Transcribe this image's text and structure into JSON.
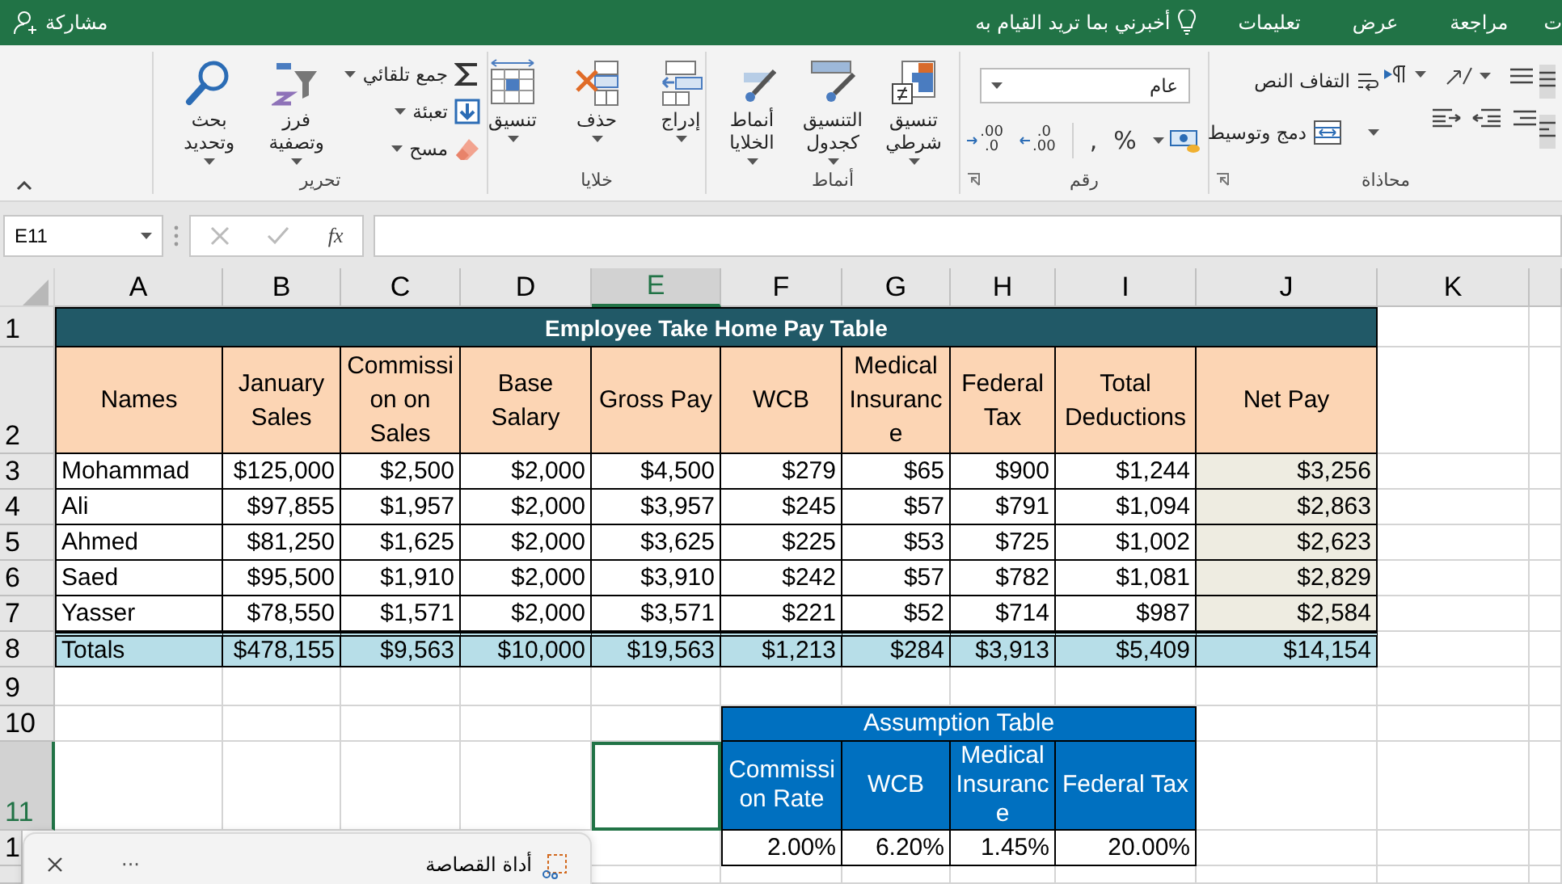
{
  "tabs": [
    {
      "label": "ت",
      "selected": false
    },
    {
      "label": "مراجعة",
      "selected": false
    },
    {
      "label": "عرض",
      "selected": false
    },
    {
      "label": "تعليمات",
      "selected": false
    }
  ],
  "tell_me": "أخبرني بما تريد القيام به",
  "share": "مشاركة",
  "ribbon": {
    "alignment": {
      "label": "محاذاة",
      "wrap_text": "التفاف النص",
      "merge_center": "دمج وتوسيط"
    },
    "number": {
      "label": "رقم",
      "format": "عام",
      "percent": "%",
      "comma": ",",
      "decimal_buttons": [
        {
          "kind": "decrease",
          "top": ".00",
          "bottom": ".0"
        },
        {
          "kind": "increase",
          "top": ".0",
          "bottom": ".00"
        }
      ]
    },
    "styles": {
      "label": "أنماط",
      "buttons": [
        {
          "kind": "conditional",
          "label": "تنسيق شرطي"
        },
        {
          "kind": "table",
          "label": "التنسيق كجدول"
        },
        {
          "kind": "cell_styles",
          "label": "أنماط الخلايا"
        }
      ]
    },
    "cells": {
      "label": "خلايا",
      "buttons": [
        {
          "kind": "insert",
          "label": "إدراج"
        },
        {
          "kind": "delete",
          "label": "حذف"
        },
        {
          "kind": "format",
          "label": "تنسيق"
        }
      ]
    },
    "editing": {
      "label": "تحرير",
      "small": [
        {
          "kind": "autosum",
          "label": "جمع تلقائي"
        },
        {
          "kind": "fill",
          "label": "تعبئة"
        },
        {
          "kind": "clear",
          "label": "مسح"
        }
      ],
      "buttons": [
        {
          "kind": "sort",
          "label": "فرز وتصفية"
        },
        {
          "kind": "find",
          "label": "بحث وتحديد"
        }
      ]
    }
  },
  "formula_bar": {
    "name_box": "E11",
    "function_button": "fx"
  },
  "column_headers": [
    {
      "label": "A",
      "selected": false
    },
    {
      "label": "B",
      "selected": false
    },
    {
      "label": "C",
      "selected": false
    },
    {
      "label": "D",
      "selected": false
    },
    {
      "label": "E",
      "selected": true
    },
    {
      "label": "F",
      "selected": false
    },
    {
      "label": "G",
      "selected": false
    },
    {
      "label": "H",
      "selected": false
    },
    {
      "label": "I",
      "selected": false
    },
    {
      "label": "J",
      "selected": false
    },
    {
      "label": "K",
      "selected": false
    }
  ],
  "row_headers": [
    {
      "label": "1",
      "selected": false
    },
    {
      "label": "2",
      "selected": false
    },
    {
      "label": "3",
      "selected": false
    },
    {
      "label": "4",
      "selected": false
    },
    {
      "label": "5",
      "selected": false
    },
    {
      "label": "6",
      "selected": false
    },
    {
      "label": "7",
      "selected": false
    },
    {
      "label": "8",
      "selected": false
    },
    {
      "label": "9",
      "selected": false
    },
    {
      "label": "10",
      "selected": false
    },
    {
      "label": "11",
      "selected": true
    },
    {
      "label": "1",
      "selected": false
    }
  ],
  "employee_table": {
    "title": "Employee Take Home Pay Table",
    "columns": [
      {
        "label": "Names",
        "shaded": false
      },
      {
        "label": "January Sales",
        "shaded": false
      },
      {
        "label": "Commission on Sales",
        "shaded": false
      },
      {
        "label": "Base Salary",
        "shaded": false
      },
      {
        "label": "Gross Pay",
        "shaded": false
      },
      {
        "label": "WCB",
        "shaded": false
      },
      {
        "label": "Medical Insurance",
        "shaded": false
      },
      {
        "label": "Federal Tax",
        "shaded": false
      },
      {
        "label": "Total Deductions",
        "shaded": false
      },
      {
        "label": "Net Pay",
        "shaded": true
      }
    ],
    "rows": [
      [
        "Mohammad",
        "$125,000",
        "$2,500",
        "$2,000",
        "$4,500",
        "$279",
        "$65",
        "$900",
        "$1,244",
        "$3,256"
      ],
      [
        "Ali",
        "$97,855",
        "$1,957",
        "$2,000",
        "$3,957",
        "$245",
        "$57",
        "$791",
        "$1,094",
        "$2,863"
      ],
      [
        "Ahmed",
        "$81,250",
        "$1,625",
        "$2,000",
        "$3,625",
        "$225",
        "$53",
        "$725",
        "$1,002",
        "$2,623"
      ],
      [
        "Saed",
        "$95,500",
        "$1,910",
        "$2,000",
        "$3,910",
        "$242",
        "$57",
        "$782",
        "$1,081",
        "$2,829"
      ],
      [
        "Yasser",
        "$78,550",
        "$1,571",
        "$2,000",
        "$3,571",
        "$221",
        "$52",
        "$714",
        "$987",
        "$2,584"
      ]
    ],
    "totals": [
      "Totals",
      "$478,155",
      "$9,563",
      "$10,000",
      "$19,563",
      "$1,213",
      "$284",
      "$3,913",
      "$5,409",
      "$14,154"
    ]
  },
  "assumption_table": {
    "title": "Assumption Table",
    "headers": [
      "Commission Rate",
      "WCB",
      "Medical Insurance",
      "Federal Tax"
    ],
    "values": [
      "2.00%",
      "6.20%",
      "1.45%",
      "20.00%"
    ]
  },
  "snipping_bar": {
    "title": "أداة القصاصة",
    "more": "···"
  }
}
